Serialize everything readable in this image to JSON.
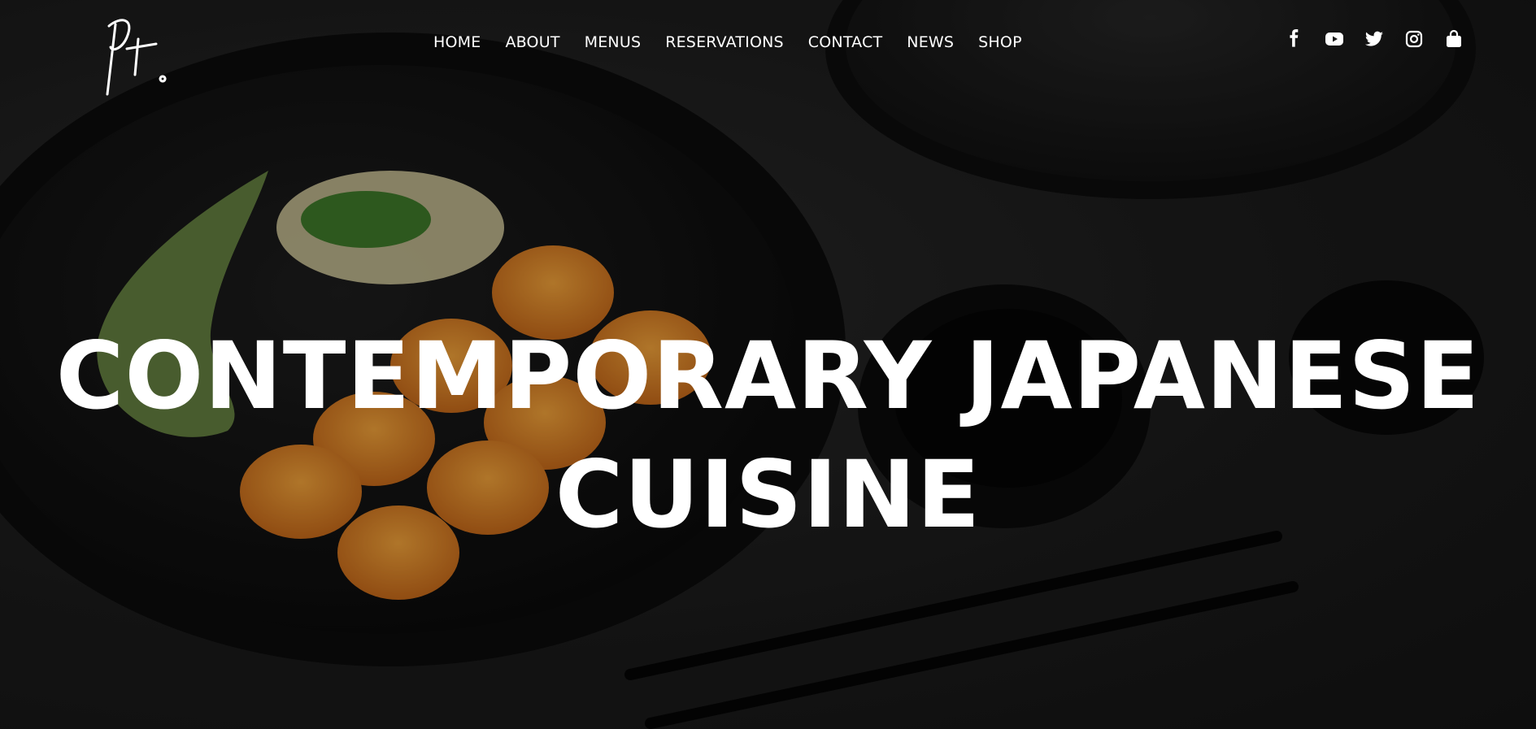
{
  "site": {
    "logo_text": "Pt."
  },
  "nav": {
    "items": [
      {
        "label": "HOME"
      },
      {
        "label": "ABOUT"
      },
      {
        "label": "MENUS"
      },
      {
        "label": "RESERVATIONS"
      },
      {
        "label": "CONTACT"
      },
      {
        "label": "NEWS"
      },
      {
        "label": "SHOP"
      }
    ]
  },
  "social": {
    "icons": [
      "facebook-icon",
      "youtube-icon",
      "twitter-icon",
      "instagram-icon",
      "shopping-bag-icon"
    ]
  },
  "hero": {
    "headline_line1": "CONTEMPORARY JAPANESE",
    "headline_line2": "CUISINE"
  },
  "colors": {
    "text": "#ffffff",
    "background": "#1c1c1c",
    "accent_food": "#e08a2a",
    "accent_sauce": "#7a9a4a"
  }
}
